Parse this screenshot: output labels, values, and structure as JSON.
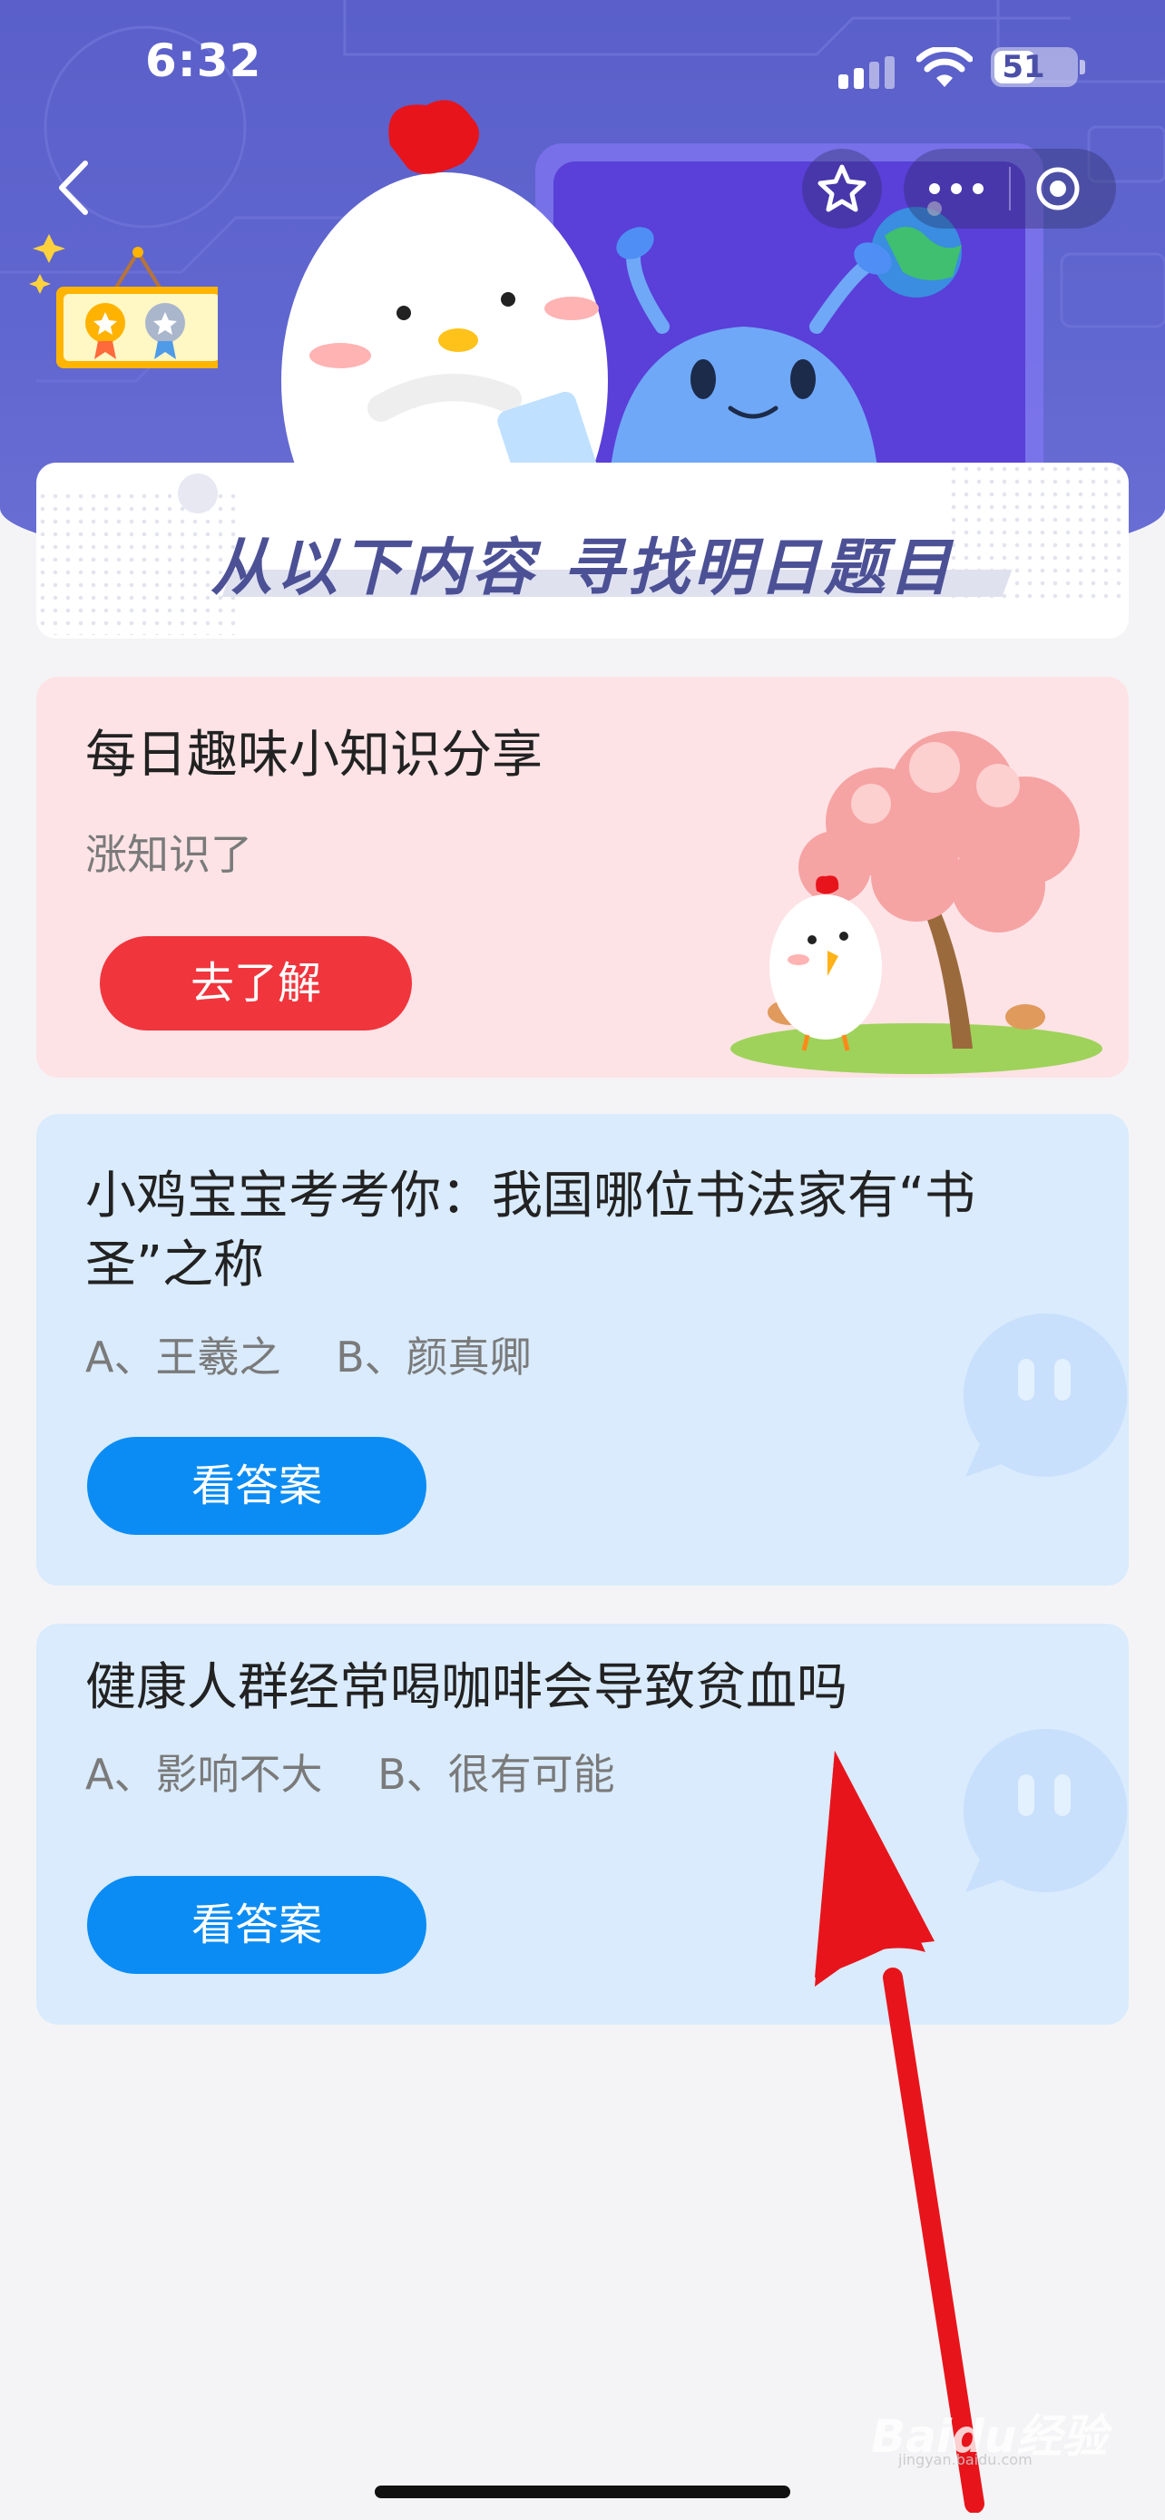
{
  "status_bar": {
    "time": "6:32",
    "battery": "51",
    "battery_level": 0.51
  },
  "nav": {
    "back_icon": "chevron-left-icon",
    "favorite_icon": "star-icon",
    "more_icon": "more-dots-icon",
    "close_icon": "target-circle-icon"
  },
  "banner": {
    "title": "从以下内容 寻找明日题目"
  },
  "cards": [
    {
      "title": "每日趣味小知识分享",
      "subtitle": "涨知识了",
      "button": "去了解"
    },
    {
      "title_line1": "小鸡宝宝考考你：我国哪位书法家有“书",
      "title_line2": "圣”之称",
      "options": "A、王羲之　 B、颜真卿",
      "button": "看答案"
    },
    {
      "title": "健康人群经常喝咖啡会导致贫血吗",
      "options": "A、影响不大　 B、很有可能",
      "button": "看答案"
    }
  ],
  "watermark": {
    "brand": "Baidu经验",
    "site": "jingyan.baidu.com"
  },
  "colors": {
    "header": "#5a5fc9",
    "red_button": "#f1353d",
    "blue_button": "#0b8cf4",
    "pink_card": "#fde3e6",
    "blue_card": "#d9ebfd",
    "arrow": "#e8141b"
  }
}
